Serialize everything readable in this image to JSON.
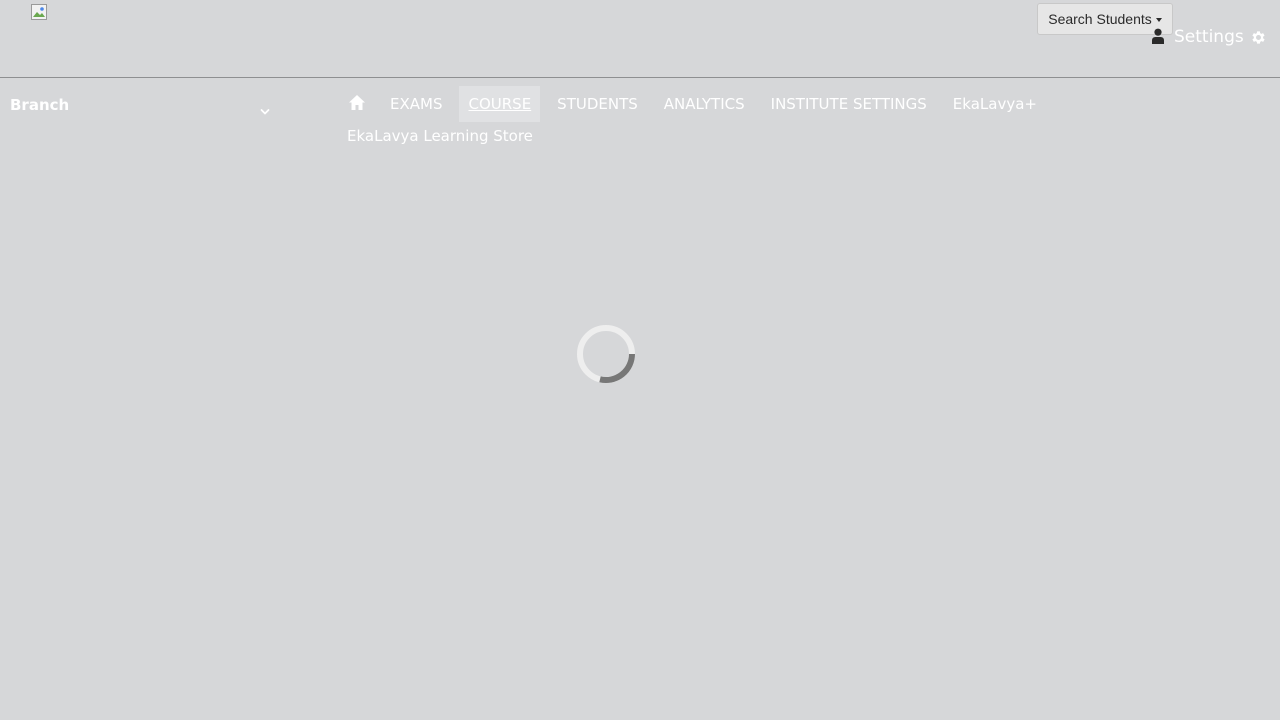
{
  "header": {
    "search_students_label": "Search Students",
    "settings_label": "Settings",
    "icons": {
      "logo": "broken-image-icon",
      "user": "user-icon",
      "settings": "gear-icon",
      "dropdown": "caret-down-icon"
    }
  },
  "branch": {
    "label": "Branch",
    "icon": "chevron-down-icon"
  },
  "nav": {
    "home_icon": "home-icon",
    "items": [
      {
        "label": "EXAMS",
        "active": false
      },
      {
        "label": "COURSE",
        "active": true
      },
      {
        "label": "STUDENTS",
        "active": false
      },
      {
        "label": "ANALYTICS",
        "active": false
      },
      {
        "label": "INSTITUTE SETTINGS",
        "active": false
      },
      {
        "label": "EkaLavya+",
        "active": false
      },
      {
        "label": "EkaLavya Learning Store",
        "active": false
      }
    ]
  },
  "loading": {
    "icon": "loading-spinner-icon"
  },
  "colors": {
    "background": "#d6d7d9",
    "nav_text": "#ffffff",
    "active_tab_bg": "#e0e1e3",
    "spinner_track": "#eeeeee",
    "spinner_arc": "#777777"
  }
}
